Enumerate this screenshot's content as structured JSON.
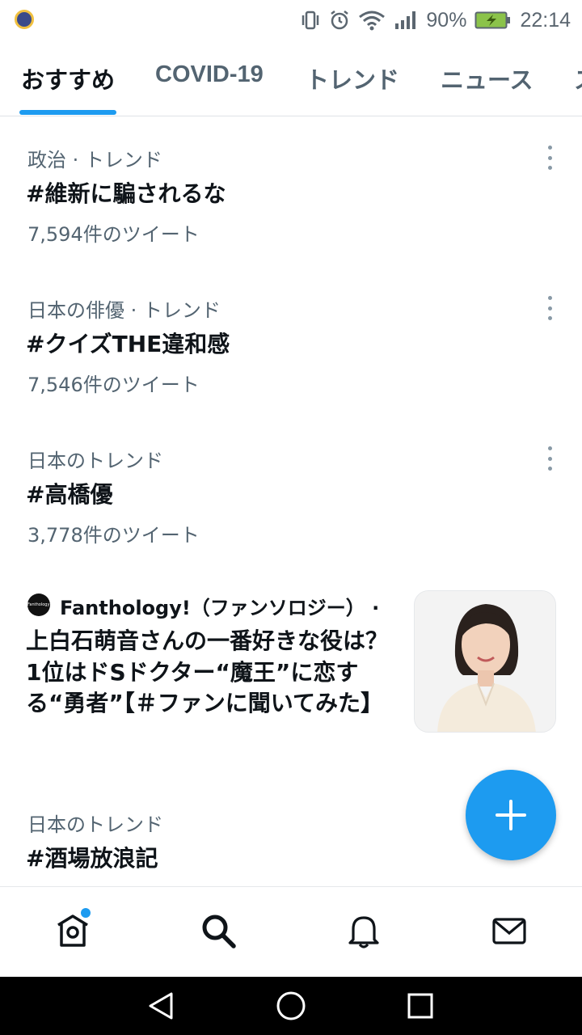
{
  "status_bar": {
    "battery_percent": "90%",
    "time": "22:14",
    "icons": [
      "vibrate-icon",
      "alarm-icon",
      "wifi-icon",
      "signal-icon",
      "battery-charging-icon"
    ]
  },
  "tabs": [
    {
      "label": "おすすめ",
      "active": true
    },
    {
      "label": "COVID-19",
      "active": false
    },
    {
      "label": "トレンド",
      "active": false
    },
    {
      "label": "ニュース",
      "active": false
    },
    {
      "label": "ス",
      "active": false
    }
  ],
  "trends": [
    {
      "meta": "政治 · トレンド",
      "title": "#維新に騙されるな",
      "count": "7,594件のツイート"
    },
    {
      "meta": "日本の俳優 · トレンド",
      "title": "#クイズTHE違和感",
      "count": "7,546件のツイート"
    },
    {
      "meta": "日本のトレンド",
      "title": "#高橋優",
      "count": "3,778件のツイート"
    },
    {
      "meta": "日本のトレンド",
      "title": "#酒場放浪記",
      "count": ""
    }
  ],
  "news": {
    "logo_text": "Fanthology!",
    "source": "Fanthology!（ファンソロジー） ·",
    "headline": "上白石萌音さんの一番好きな役は？ 1位はドSドクター“魔王”に恋する“勇者”【＃ファンに聞いてみた】"
  },
  "colors": {
    "accent": "#1d9bf0",
    "text_primary": "#0f1419",
    "text_secondary": "#536471"
  },
  "bottom_nav": [
    "home-icon",
    "search-icon",
    "notifications-icon",
    "messages-icon"
  ],
  "system_nav": [
    "back-icon",
    "home-circle-icon",
    "recents-icon"
  ]
}
